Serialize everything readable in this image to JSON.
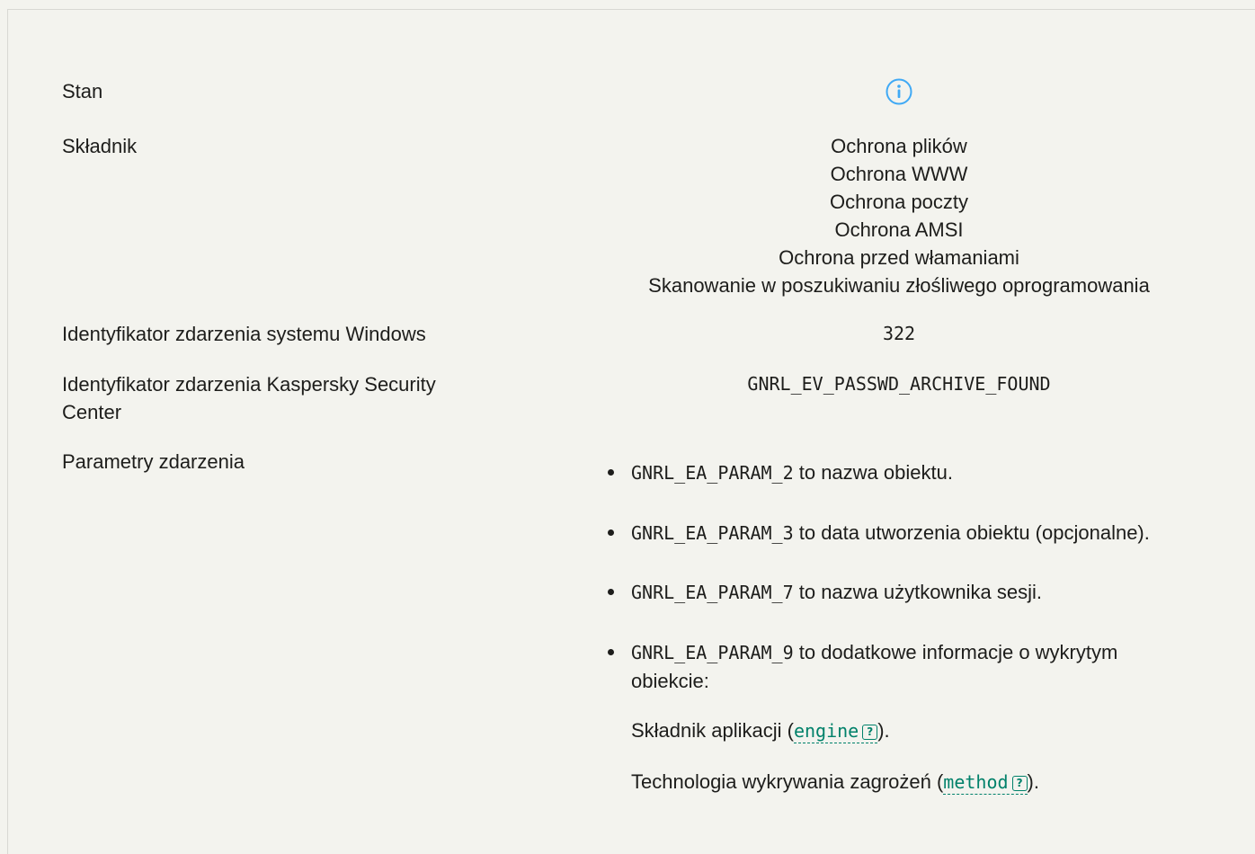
{
  "rows": {
    "state": {
      "label": "Stan",
      "icon": "info-icon"
    },
    "component": {
      "label": "Składnik",
      "values": [
        "Ochrona plików",
        "Ochrona WWW",
        "Ochrona poczty",
        "Ochrona AMSI",
        "Ochrona przed włamaniami",
        "Skanowanie w poszukiwaniu złośliwego oprogramowania"
      ]
    },
    "windows_event_id": {
      "label": "Identyfikator zdarzenia systemu Windows",
      "value": "322"
    },
    "ksc_event_id": {
      "label_line1": "Identyfikator zdarzenia Kaspersky Security",
      "label_line2": "Center",
      "value": "GNRL_EV_PASSWD_ARCHIVE_FOUND"
    },
    "event_params": {
      "label": "Parametry zdarzenia",
      "items": [
        {
          "code": "GNRL_EA_PARAM_2",
          "text": " to nazwa obiektu."
        },
        {
          "code": "GNRL_EA_PARAM_3",
          "text": " to data utworzenia obiektu (opcjonalne)."
        },
        {
          "code": "GNRL_EA_PARAM_7",
          "text": " to nazwa użytkownika sesji."
        },
        {
          "code": "GNRL_EA_PARAM_9",
          "text": " to dodatkowe informacje o wykrytym",
          "text2": "obiekcie:"
        }
      ],
      "sub": [
        {
          "prefix": "Składnik aplikacji (",
          "term": "engine",
          "suffix": ")."
        },
        {
          "prefix": "Technologia wykrywania zagrożeń (",
          "term": "method",
          "suffix": ")."
        }
      ],
      "help_glyph": "?"
    }
  },
  "colors": {
    "accent": "#00816a",
    "info_icon": "#3fa9f5",
    "background": "#f3f3ee"
  }
}
